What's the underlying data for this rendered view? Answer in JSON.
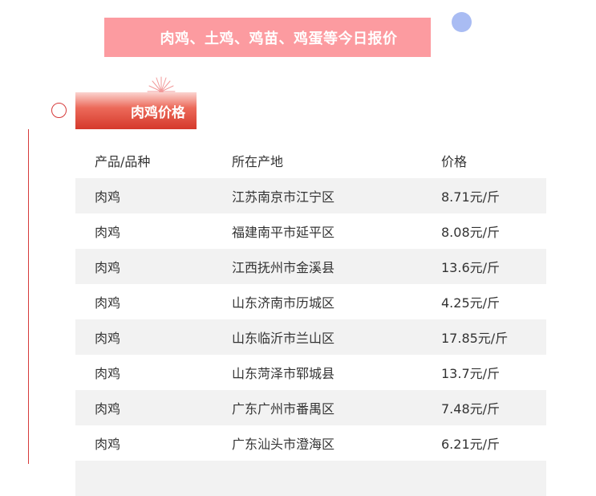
{
  "banner": {
    "title": "肉鸡、土鸡、鸡苗、鸡蛋等今日报价"
  },
  "section": {
    "title": "肉鸡价格"
  },
  "table": {
    "headers": [
      "产品/品种",
      "所在产地",
      "价格"
    ],
    "rows": [
      [
        "肉鸡",
        "江苏南京市江宁区",
        "8.71元/斤"
      ],
      [
        "肉鸡",
        "福建南平市延平区",
        "8.08元/斤"
      ],
      [
        "肉鸡",
        "江西抚州市金溪县",
        "13.6元/斤"
      ],
      [
        "肉鸡",
        "山东济南市历城区",
        "4.25元/斤"
      ],
      [
        "肉鸡",
        "山东临沂市兰山区",
        "17.85元/斤"
      ],
      [
        "肉鸡",
        "山东菏泽市郓城县",
        "13.7元/斤"
      ],
      [
        "肉鸡",
        "广东广州市番禺区",
        "7.48元/斤"
      ],
      [
        "肉鸡",
        "广东汕头市澄海区",
        "6.21元/斤"
      ]
    ]
  },
  "colors": {
    "banner_bg": "#fc9ba0",
    "accent_red": "#d63a3a",
    "dot_blue": "#a9bcf3",
    "row_alt_bg": "#f2f2f2"
  }
}
